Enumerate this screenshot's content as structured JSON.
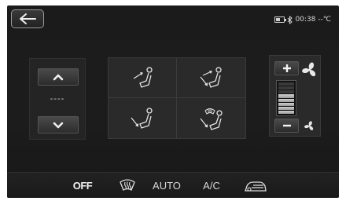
{
  "status": {
    "time": "00:38",
    "temperature": "--℃"
  },
  "temperature": {
    "value": "----"
  },
  "fan": {
    "level": 0.6,
    "segments_total": 8,
    "segments_on": 5
  },
  "airflow_modes": [
    {
      "name": "face",
      "icon": "face-airflow-icon"
    },
    {
      "name": "face-and-feet",
      "icon": "face-feet-airflow-icon"
    },
    {
      "name": "feet",
      "icon": "feet-airflow-icon"
    },
    {
      "name": "feet-and-defrost",
      "icon": "feet-defrost-airflow-icon"
    }
  ],
  "bottom_bar": {
    "off_label": "OFF",
    "auto_label": "AUTO",
    "ac_label": "A/C"
  },
  "colors": {
    "background": "#1b1b1b",
    "panel": "#2a2a2a",
    "text": "#e8e8e8"
  }
}
